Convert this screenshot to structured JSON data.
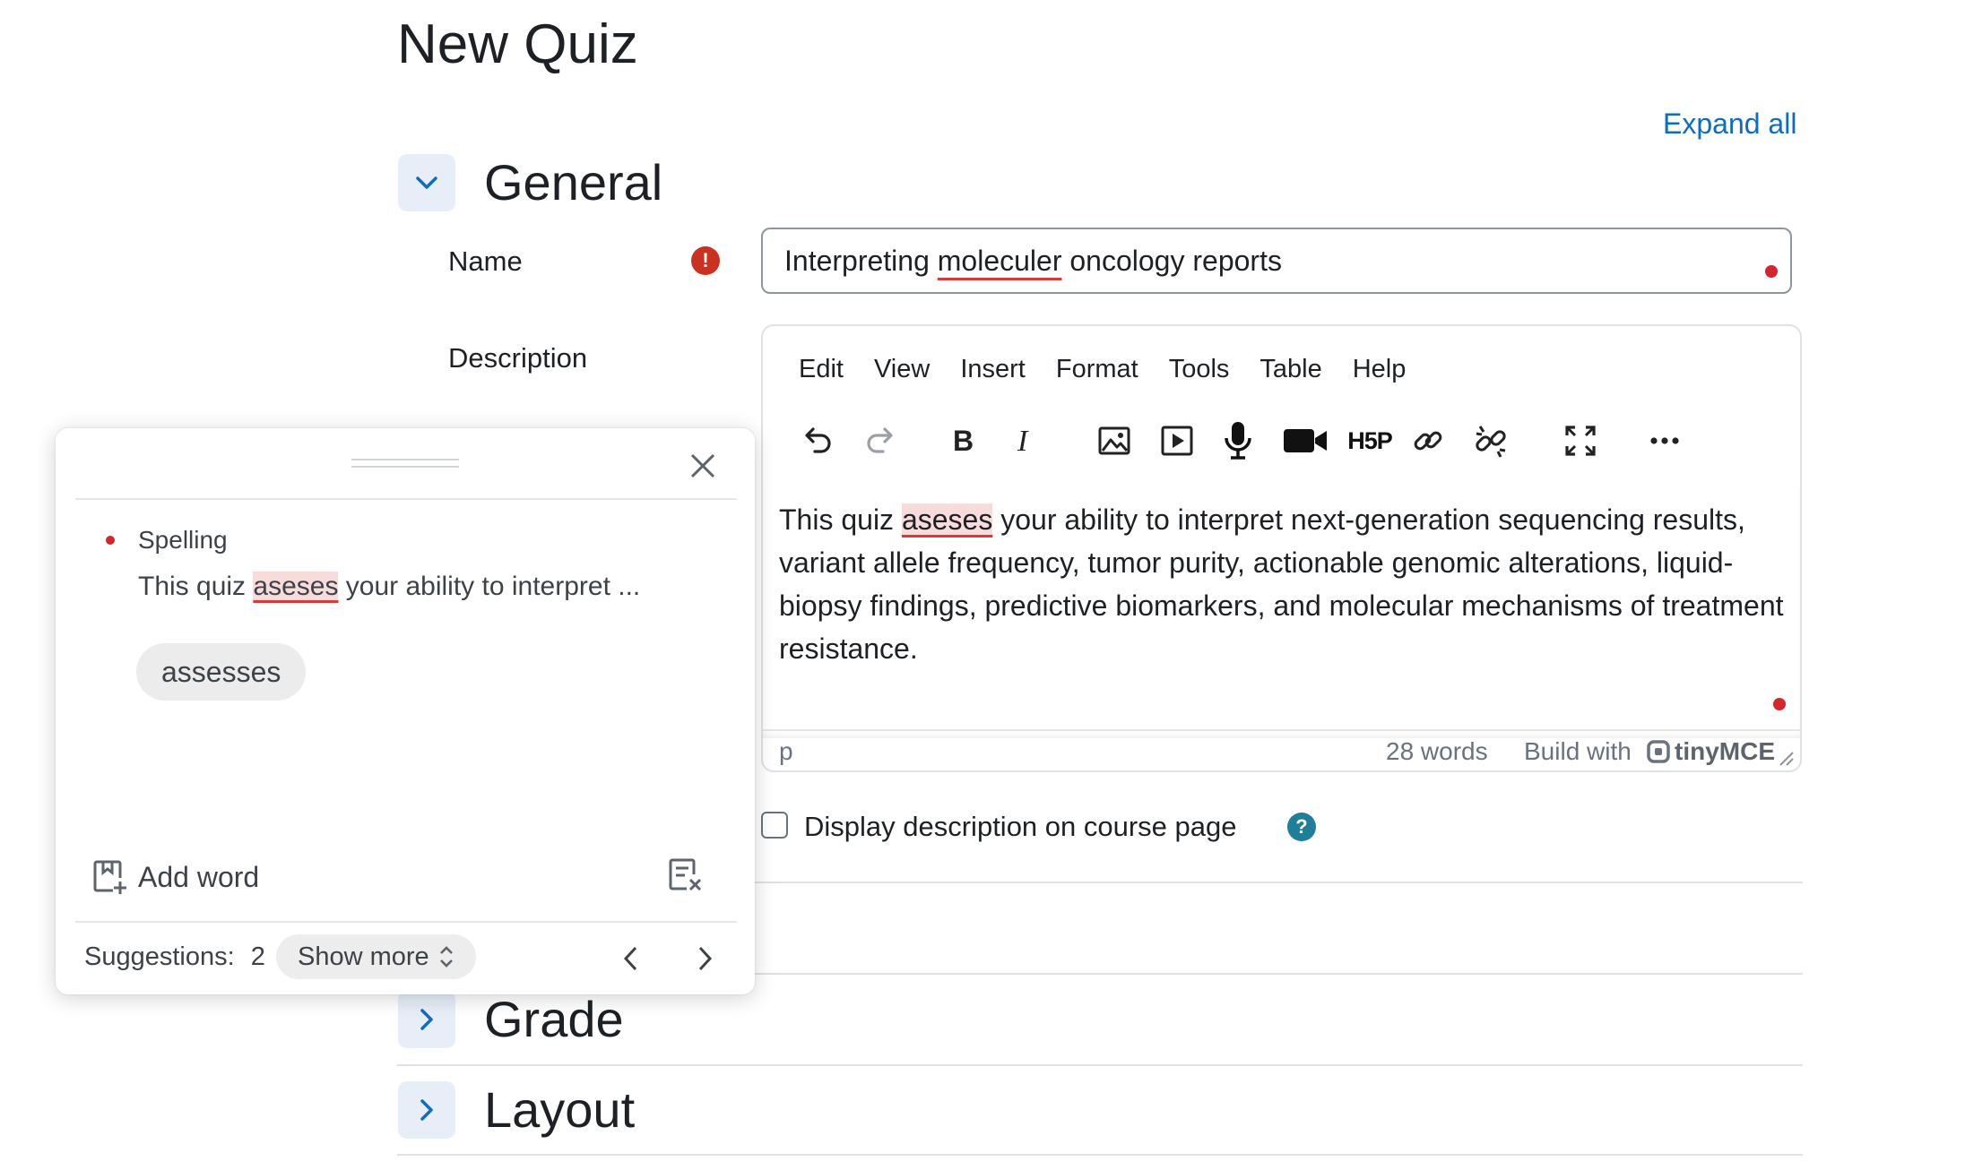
{
  "page": {
    "title": "New Quiz",
    "expand_all": "Expand all"
  },
  "sections": {
    "general": "General",
    "grade": "Grade",
    "layout": "Layout"
  },
  "form": {
    "name_label": "Name",
    "name_value_before": "Interpreting ",
    "name_value_misspelled": "moleculer",
    "name_value_after": " oncology reports",
    "description_label": "Description",
    "display_description_label": "Display description on course page"
  },
  "editor": {
    "menu": [
      "Edit",
      "View",
      "Insert",
      "Format",
      "Tools",
      "Table",
      "Help"
    ],
    "toolbar_icons": [
      "undo-icon",
      "redo-icon",
      "bold-icon",
      "italic-icon",
      "image-icon",
      "media-icon",
      "microphone-icon",
      "video-camera-icon",
      "h5p-icon",
      "link-icon",
      "unlink-icon",
      "fullscreen-icon",
      "more-icon"
    ],
    "h5p_label": "H5P",
    "content_before": "This quiz ",
    "content_misspelled": "aseses",
    "content_after": " your ability to interpret next-generation sequencing results, variant allele frequency, tumor purity, actionable genomic alterations, liquid-biopsy findings, predictive biomarkers, and molecular mechanisms of treatment resistance.",
    "status_path": "p",
    "word_count": "28 words",
    "build_with": "Build with",
    "brand": "tinyMCE"
  },
  "spell_panel": {
    "category": "Spelling",
    "context_before": "This quiz ",
    "context_word": "aseses",
    "context_after": " your ability to interpret ...",
    "suggestion": "assesses",
    "add_word": "Add word",
    "suggestions_label": "Suggestions:",
    "suggestions_count": "2",
    "show_more": "Show more"
  },
  "colors": {
    "accent": "#0f6cbf",
    "error": "#ca3120",
    "help": "#1f7e9a",
    "toggle_bg": "#e7eef8"
  }
}
